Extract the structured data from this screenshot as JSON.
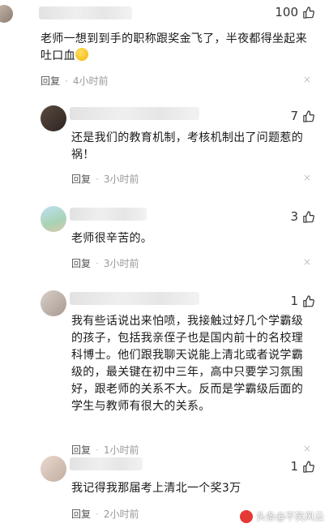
{
  "comments": [
    {
      "likes": "100",
      "text": "老师一想到到手的职称跟奖金飞了，半夜都得坐起来吐口血",
      "reply": "回复",
      "time": "4小时前"
    },
    {
      "likes": "7",
      "text": "还是我们的教育机制，考核机制出了问题惹的祸！",
      "reply": "回复",
      "time": "3小时前"
    },
    {
      "likes": "3",
      "text": "老师很辛苦的。",
      "reply": "回复",
      "time": "3小时前"
    },
    {
      "likes": "1",
      "text": "我有些话说出来怕喷，我接触过好几个学霸级的孩子，包括我亲侄子也是国内前十的名校理科博士。他们跟我聊天说能上清北或者说学霸级的，最关键在初中三年，高中只要学习氛围好，跟老师的关系不大。反而是学霸级后面的学生与教师有很大的关系。",
      "reply": "回复",
      "time": "1小时前"
    },
    {
      "likes": "1",
      "text": "我记得我那届考上清北一个奖3万",
      "reply": "回复",
      "time": "2小时前"
    }
  ],
  "separator": "·",
  "close_glyph": "×",
  "watermark": "头条@不笑风云",
  "icons": {
    "like": "thumbs-up-icon",
    "close": "close-icon",
    "emoji": "emoji-icon",
    "logo": "toutiao-logo-icon"
  },
  "colors": {
    "text": "#1a1a1a",
    "meta": "#999999",
    "close": "#c4c4c4"
  }
}
